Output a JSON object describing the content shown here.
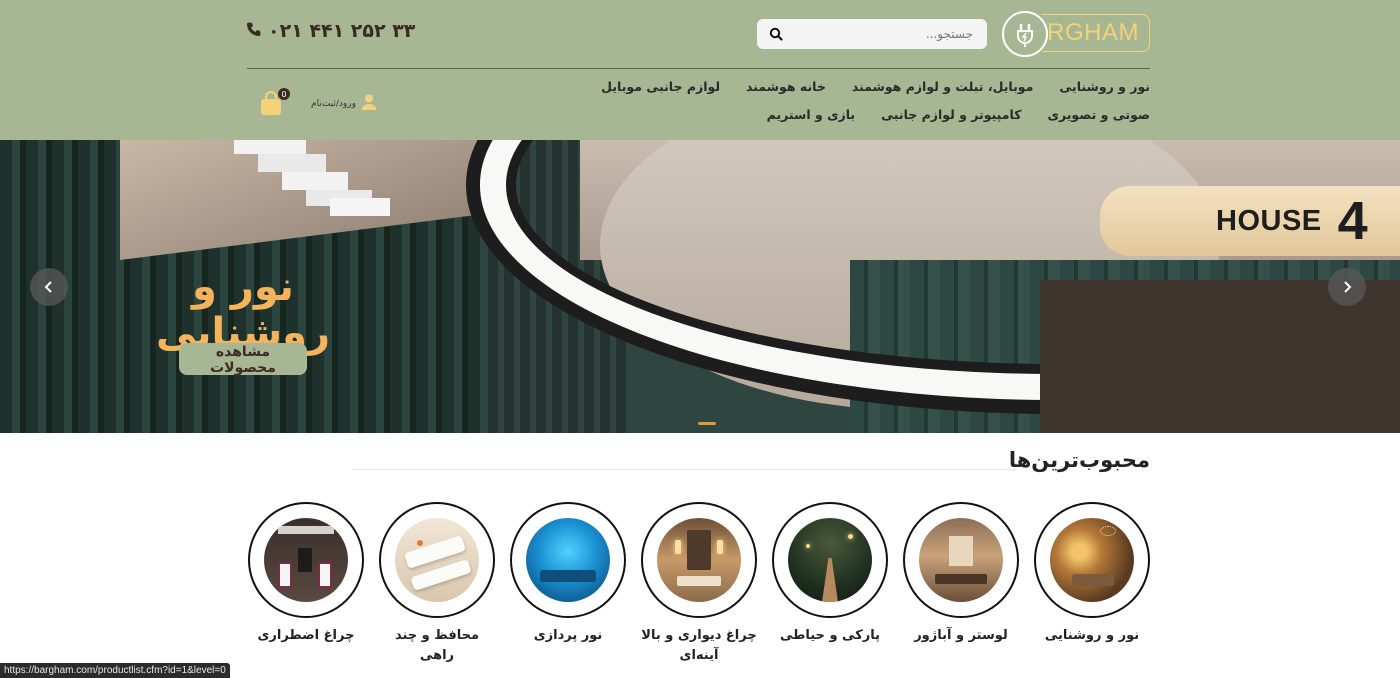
{
  "header": {
    "logo_text": "BARGHAM",
    "search": {
      "placeholder": "جستجو..."
    },
    "phone": "۰۲۱ ۴۴۱ ۲۵۲ ۳۳",
    "nav": [
      "نور و روشنایی",
      "موبایل، تبلت و لوازم هوشمند",
      "خانه هوشمند",
      "لوازم جانبی موبایل",
      "صوتی و تصویری",
      "کامپیوتر و لوازم جانبی",
      "بازی و استریم"
    ],
    "login_label": "ورود/ثبت‌نام",
    "cart_count": "0"
  },
  "hero": {
    "title": "نور و روشنایی",
    "button_label": "مشاهده محصولات",
    "sign_word": "HOUSE",
    "sign_number": "4"
  },
  "popular": {
    "title": "محبوب‌ترین‌ها",
    "categories": [
      {
        "label": "نور و روشنایی"
      },
      {
        "label": "لوستر و آباژور"
      },
      {
        "label": "پارکی و حیاطی"
      },
      {
        "label": "چراغ دیواری و بالا آینه‌ای"
      },
      {
        "label": "نور پردازی"
      },
      {
        "label": "محافظ و چند راهی"
      },
      {
        "label": "چراغ اضطراری"
      }
    ]
  },
  "status_bar": "https://bargham.com/productlist.cfm?id=1&level=0",
  "colors": {
    "header_bg": "#a7b693",
    "accent_gold": "#f4d27a",
    "hero_title": "#f5b45b",
    "dark_brown": "#3a2c22"
  }
}
